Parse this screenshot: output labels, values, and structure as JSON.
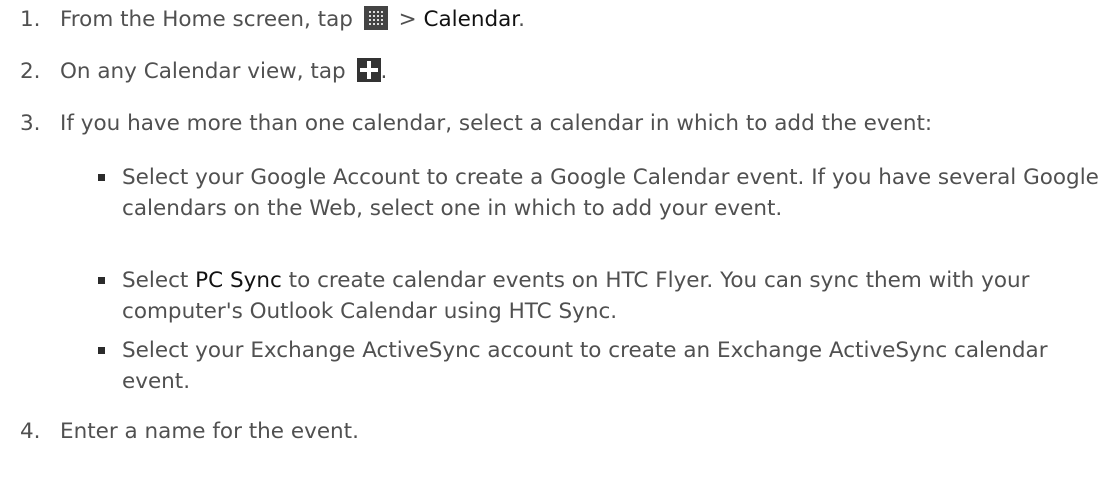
{
  "steps": [
    {
      "number": "1.",
      "parts": [
        "From the Home screen, tap ",
        " > ",
        "Calendar",
        "."
      ],
      "icon": "apps-grid-icon"
    },
    {
      "number": "2.",
      "parts": [
        "On any Calendar view, tap ",
        "."
      ],
      "icon": "add-plus-icon"
    },
    {
      "number": "3.",
      "text": "If you have more than one calendar, select a calendar in which to add the event:"
    },
    {
      "number": "4.",
      "text": "Enter a name for the event."
    }
  ],
  "bullets": [
    {
      "text": "Select your Google Account to create a Google Calendar event. If you have several Google calendars on the Web, select one in which to add your event."
    },
    {
      "pre": "Select ",
      "highlight": "PC Sync",
      "post": " to create calendar events on HTC Flyer. You can sync them with your computer's Outlook Calendar using HTC Sync."
    },
    {
      "text": "Select your Exchange ActiveSync account to create an Exchange ActiveSync calendar event."
    }
  ],
  "colors": {
    "body_text": "#505050",
    "highlight_text": "#111111",
    "icon_background": "#444444"
  }
}
